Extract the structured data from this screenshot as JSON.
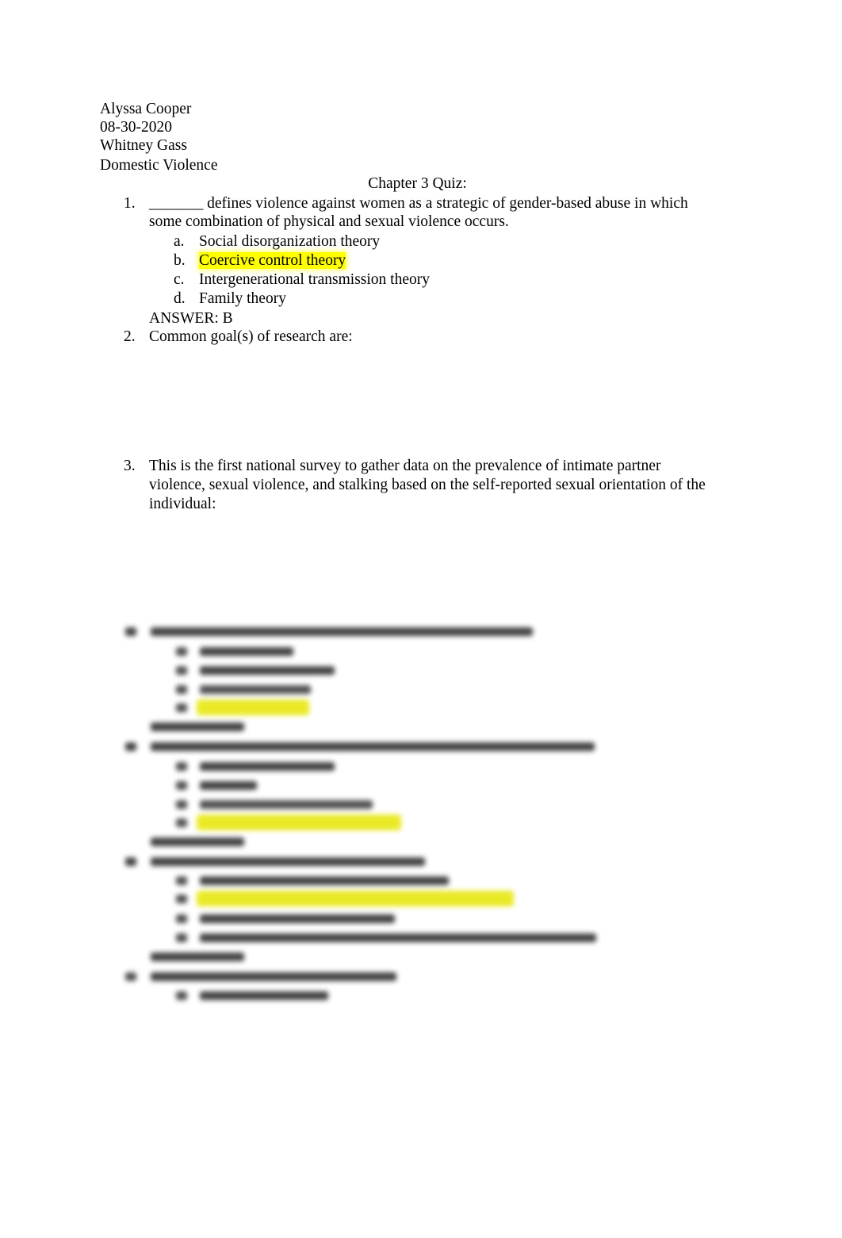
{
  "header": {
    "student_name": "Alyssa Cooper",
    "date": "08-30-2020",
    "instructor": "Whitney Gass",
    "course": "Domestic Violence"
  },
  "title": "Chapter 3 Quiz:",
  "questions": [
    {
      "number": "1.",
      "text_line1": "_______ defines violence against women as a strategic of gender-based abuse in which",
      "text_line2": "some combination of physical and sexual violence occurs.",
      "options": [
        {
          "letter": "a.",
          "text": "Social disorganization theory",
          "highlighted": false
        },
        {
          "letter": "b.",
          "text": "Coercive control theory",
          "highlighted": true
        },
        {
          "letter": "c.",
          "text": "Intergenerational transmission theory",
          "highlighted": false
        },
        {
          "letter": "d.",
          "text": "Family theory",
          "highlighted": false
        }
      ],
      "answer": "ANSWER: B"
    },
    {
      "number": "2.",
      "text_line1": "Common goal(s) of research are:"
    },
    {
      "number": "3.",
      "text_line1": "This is the first national survey to gather data on the prevalence of intimate partner",
      "text_line2": "violence, sexual violence, and stalking based on the self-reported sexual orientation of the",
      "text_line3": "individual:"
    }
  ],
  "blurred_preview": {
    "description": "Remaining questions 4-7 are blurred (obscured preview)",
    "highlight_color": "#ffff00"
  },
  "colors": {
    "text": "#000000",
    "highlight": "#ffff00",
    "background": "#ffffff"
  }
}
